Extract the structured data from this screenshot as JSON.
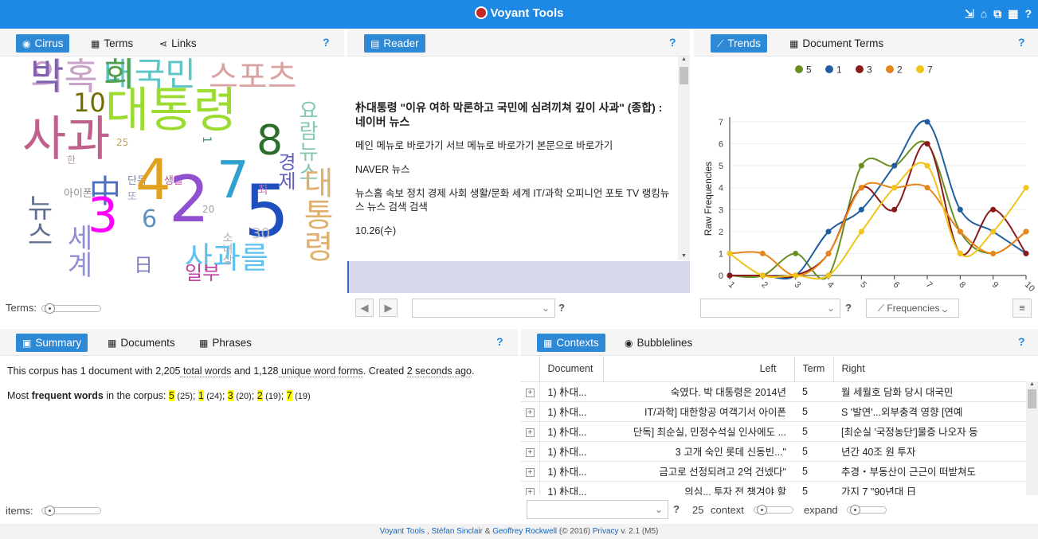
{
  "app": {
    "title": "Voyant Tools",
    "icons": [
      "export-icon",
      "home-icon",
      "open-icon",
      "windows-icon",
      "help-icon"
    ],
    "brand_color": "#1e88e5"
  },
  "cirrus": {
    "tabs": {
      "cirrus": "Cirrus",
      "terms": "Terms",
      "links": "Links"
    },
    "help": "?",
    "terms_label": "Terms:",
    "words": [
      {
        "text": "의혹",
        "color": "#c8a2c8"
      },
      {
        "text": "대국민",
        "color": "#5cc5c5"
      },
      {
        "text": "스포츠",
        "color": "#d9a3a3"
      },
      {
        "text": "요람뉴스",
        "color": "#85c7b0"
      },
      {
        "text": "10",
        "color": "#6e6e00"
      },
      {
        "text": "대통령",
        "color": "#9cdc32"
      },
      {
        "text": "8",
        "color": "#2d6e2d"
      },
      {
        "text": "25",
        "color": "#caa04a"
      },
      {
        "text": "사과",
        "color": "#c0608c"
      },
      {
        "text": "한",
        "color": "#b0a0a0"
      },
      {
        "text": "단독",
        "color": "#8080a0"
      },
      {
        "text": "생활",
        "color": "#c050a0"
      },
      {
        "text": "경제",
        "color": "#6060c0"
      },
      {
        "text": "대통령",
        "color": "#e0b070"
      },
      {
        "text": "아이폰",
        "color": "#909090"
      },
      {
        "text": "또",
        "color": "#a0a0c0"
      },
      {
        "text": "4",
        "color": "#e0a020"
      },
      {
        "text": "中",
        "color": "#5070c0"
      },
      {
        "text": "2",
        "color": "#9050d0"
      },
      {
        "text": "7",
        "color": "#30a0d0"
      },
      {
        "text": "5",
        "color": "#2050c0"
      },
      {
        "text": "뉴스",
        "color": "#607090"
      },
      {
        "text": "3",
        "color": "#ff00ff"
      },
      {
        "text": "6",
        "color": "#6090c0"
      },
      {
        "text": "1",
        "color": "#409080"
      },
      {
        "text": "20",
        "color": "#a0a0a0"
      },
      {
        "text": "최",
        "color": "#c070b0"
      },
      {
        "text": "30",
        "color": "#c0c0c0"
      },
      {
        "text": "세계",
        "color": "#9090d0"
      },
      {
        "text": "日",
        "color": "#8080c0"
      },
      {
        "text": "사과를",
        "color": "#60c0f0"
      },
      {
        "text": "일부",
        "color": "#c040a0"
      },
      {
        "text": "소녀상",
        "color": "#b0b0b0"
      },
      {
        "text": "박",
        "color": "#8060b0"
      },
      {
        "text": "회",
        "color": "#50a050"
      }
    ]
  },
  "reader": {
    "tab": "Reader",
    "help": "?",
    "title": "朴대통령 \"이유 여하 막론하고 국민에 심려끼쳐 깊이 사과\" (종합) : 네이버 뉴스",
    "paragraphs": [
      "메인 메뉴로 바로가기 서브 메뉴로 바로가기 본문으로 바로가기",
      "NAVER 뉴스",
      "뉴스홈 속보 정치 경제 사회 생활/문화 세계 IT/과학 오피니언 포토 TV 랭킹뉴스 뉴스 검색 검색",
      "10.26(수)"
    ],
    "prev": "◀",
    "next": "▶"
  },
  "trends": {
    "tabs": {
      "trends": "Trends",
      "docterms": "Document Terms"
    },
    "help": "?",
    "freq_button": "Frequencies",
    "chart_data": {
      "type": "line",
      "x": [
        1,
        2,
        3,
        4,
        5,
        6,
        7,
        8,
        9,
        10
      ],
      "xlabel": "Document Segments",
      "ylabel": "Raw Frequencies",
      "ylim": [
        0,
        7
      ],
      "series": [
        {
          "name": "5",
          "color": "#6b8e23",
          "values": [
            0,
            0,
            1,
            0,
            5,
            5,
            6,
            2,
            1,
            2
          ]
        },
        {
          "name": "1",
          "color": "#1f5fa0",
          "values": [
            0,
            0,
            0,
            2,
            3,
            5,
            7,
            3,
            2,
            1
          ]
        },
        {
          "name": "3",
          "color": "#8b1a1a",
          "values": [
            0,
            0,
            0,
            1,
            4,
            3,
            6,
            1,
            3,
            1
          ]
        },
        {
          "name": "2",
          "color": "#e8851a",
          "values": [
            1,
            1,
            0,
            1,
            4,
            4,
            4,
            2,
            1,
            2
          ]
        },
        {
          "name": "7",
          "color": "#f0c419",
          "values": [
            1,
            0,
            0,
            0,
            2,
            4,
            5,
            1,
            2,
            4
          ]
        }
      ]
    }
  },
  "summary": {
    "tabs": {
      "summary": "Summary",
      "documents": "Documents",
      "phrases": "Phrases"
    },
    "help": "?",
    "line1": {
      "a": "This corpus has 1 document with ",
      "b": "2,205",
      "c": " total words",
      "d": " and ",
      "e": "1,128",
      "f": " unique word forms",
      "g": ". Created ",
      "h": "2 seconds ago",
      "i": "."
    },
    "line2": {
      "a": "Most ",
      "b": "frequent words",
      "c": " in the corpus: "
    },
    "freq": [
      {
        "w": "5",
        "n": "(25)"
      },
      {
        "w": "1",
        "n": "(24)"
      },
      {
        "w": "3",
        "n": "(20)"
      },
      {
        "w": "2",
        "n": "(19)"
      },
      {
        "w": "7",
        "n": "(19)"
      }
    ],
    "items_label": "items:"
  },
  "contexts": {
    "tabs": {
      "contexts": "Contexts",
      "bubblelines": "Bubblelines"
    },
    "help": "?",
    "headers": {
      "doc": "Document",
      "left": "Left",
      "term": "Term",
      "right": "Right"
    },
    "rows": [
      {
        "doc": "1) 朴대...",
        "left": "숙였다. 박 대통령은 2014년",
        "term": "5",
        "right": "월 세월호 담화 당시 대국민"
      },
      {
        "doc": "1) 朴대...",
        "left": "IT/과학] 대한항공 여객기서 아이폰",
        "term": "5",
        "right": "S '발연'...외부충격 영향 [연예"
      },
      {
        "doc": "1) 朴대...",
        "left": "단독] 최순실, 민정수석실 인사에도 ...",
        "term": "5",
        "right": "[최순실 '국정농단']물증 나오자 등"
      },
      {
        "doc": "1) 朴대...",
        "left": "3 고개 숙인 롯데 신동빈...\"",
        "term": "5",
        "right": "년간 40조 원 투자"
      },
      {
        "doc": "1) 朴대...",
        "left": "금고로 선정되려고 2억 건넸다\"",
        "term": "5",
        "right": "추경・부동산이 근근이 떠받쳐도"
      },
      {
        "doc": "1) 朴대...",
        "left": "의심... 투자 전 챙겨야 할",
        "term": "5",
        "right": "가지 7 \"90년대 日"
      }
    ],
    "context_value": "25",
    "context_label": "context",
    "expand_label": "expand"
  },
  "footer": {
    "a": "Voyant Tools",
    "b": " , ",
    "c": "Stéfan Sinclair",
    "d": " & ",
    "e": "Geoffrey Rockwell",
    "f": " (© 2016) ",
    "g": "Privacy",
    "h": " v. 2.1 (M5)"
  }
}
